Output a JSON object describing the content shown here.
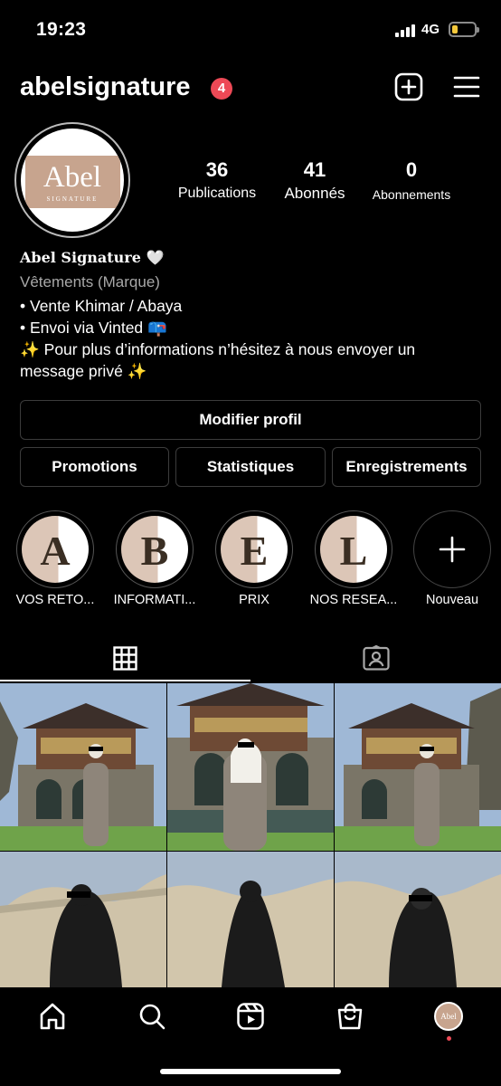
{
  "status_bar": {
    "time": "19:23",
    "network": "4G"
  },
  "header": {
    "username": "abelsignature",
    "notification_count": "4"
  },
  "profile": {
    "avatar_brand": "Abel",
    "avatar_subtext": "SIGNATURE",
    "stats": [
      {
        "value": "36",
        "label": "Publications"
      },
      {
        "value": "41",
        "label": "Abonnés"
      },
      {
        "value": "0",
        "label": "Abonnements"
      }
    ],
    "bio": {
      "name": "𝐀𝐛𝐞𝐥 𝐒𝐢𝐠𝐧𝐚𝐭𝐮𝐫𝐞 🤍",
      "category": "Vêtements (Marque)",
      "lines": [
        "• Vente Khimar / Abaya",
        "• Envoi via Vinted 📪",
        "✨ Pour plus d’informations n’hésitez à nous envoyer un",
        "message privé ✨"
      ]
    }
  },
  "buttons": {
    "edit_profile": "Modifier profil",
    "promotions": "Promotions",
    "insights": "Statistiques",
    "saved": "Enregistrements"
  },
  "highlights": [
    {
      "letter": "A",
      "label": "VOS RETO..."
    },
    {
      "letter": "B",
      "label": "INFORMATI..."
    },
    {
      "letter": "E",
      "label": "PRIX"
    },
    {
      "letter": "L",
      "label": "NOS RESEA..."
    }
  ],
  "new_highlight_label": "Nouveau",
  "tabs": [
    {
      "icon": "grid-icon",
      "active": true
    },
    {
      "icon": "tagged-person-icon",
      "active": false
    }
  ],
  "nav_avatar_text": "Abel",
  "colors": {
    "background": "#000000",
    "badge": "#ed4956",
    "brand_beige": "#c7a48e",
    "battery": "#f4c83b"
  }
}
